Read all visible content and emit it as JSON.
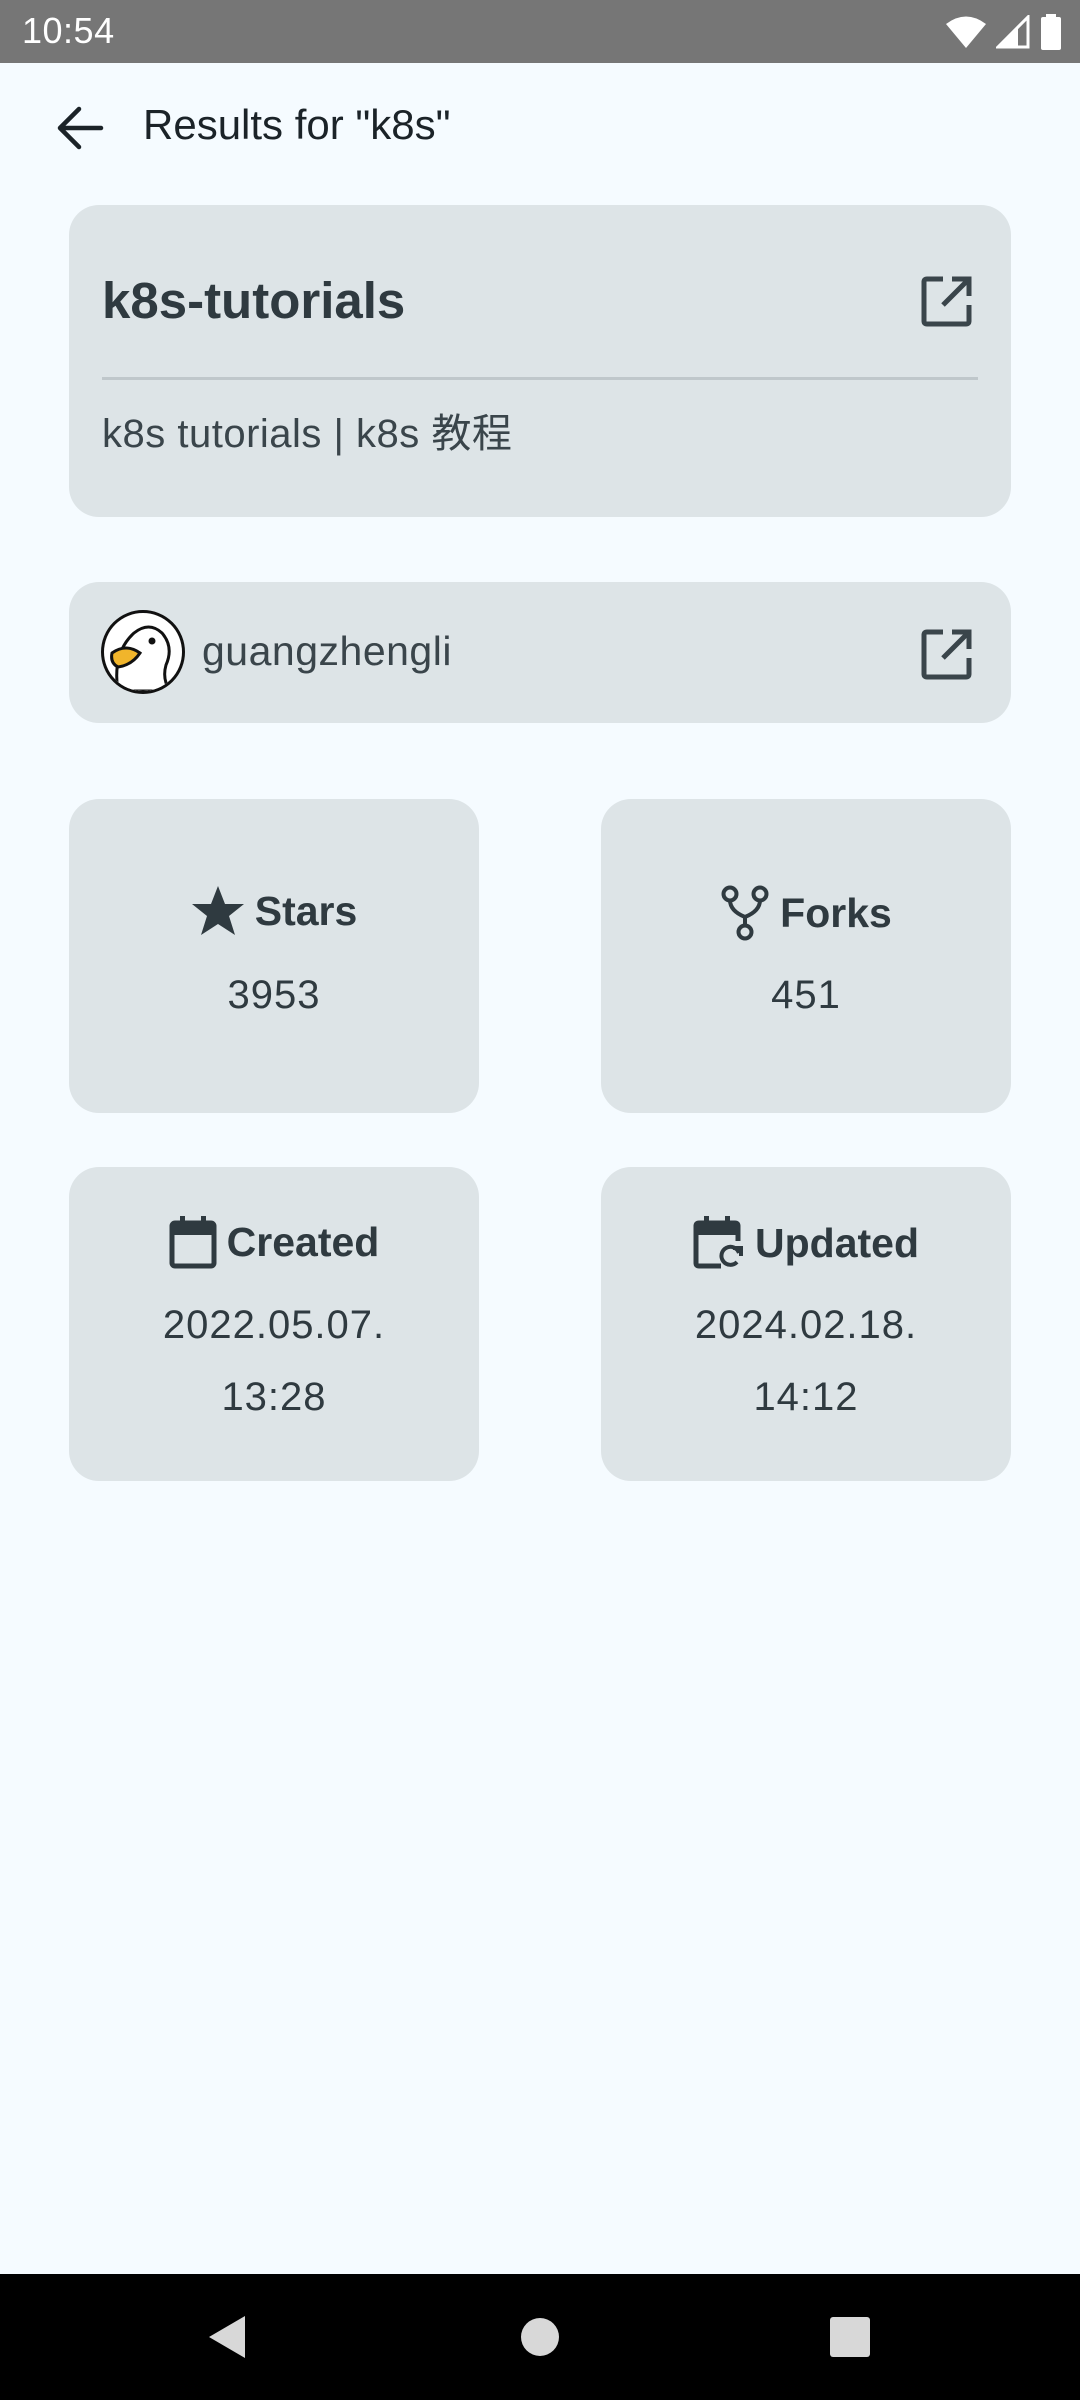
{
  "status_bar": {
    "time": "10:54"
  },
  "header": {
    "title": "Results for \"k8s\""
  },
  "repo": {
    "name": "k8s-tutorials",
    "description": "k8s tutorials | k8s 教程"
  },
  "owner": {
    "username": "guangzhengli"
  },
  "stats": {
    "stars_label": "Stars",
    "stars_value": "3953",
    "forks_label": "Forks",
    "forks_value": "451",
    "created_label": "Created",
    "created_date": "2022.05.07.",
    "created_time": "13:28",
    "updated_label": "Updated",
    "updated_date": "2024.02.18.",
    "updated_time": "14:12"
  },
  "icons": {
    "back": "arrow-back-icon",
    "open_external": "open-in-new-icon",
    "star": "star-icon",
    "fork": "fork-icon",
    "calendar": "calendar-icon",
    "calendar_update": "calendar-refresh-icon"
  },
  "colors": {
    "background": "#f5fbff",
    "card": "#dde4e7",
    "text": "#2f3a40",
    "status_bar": "#767676"
  }
}
